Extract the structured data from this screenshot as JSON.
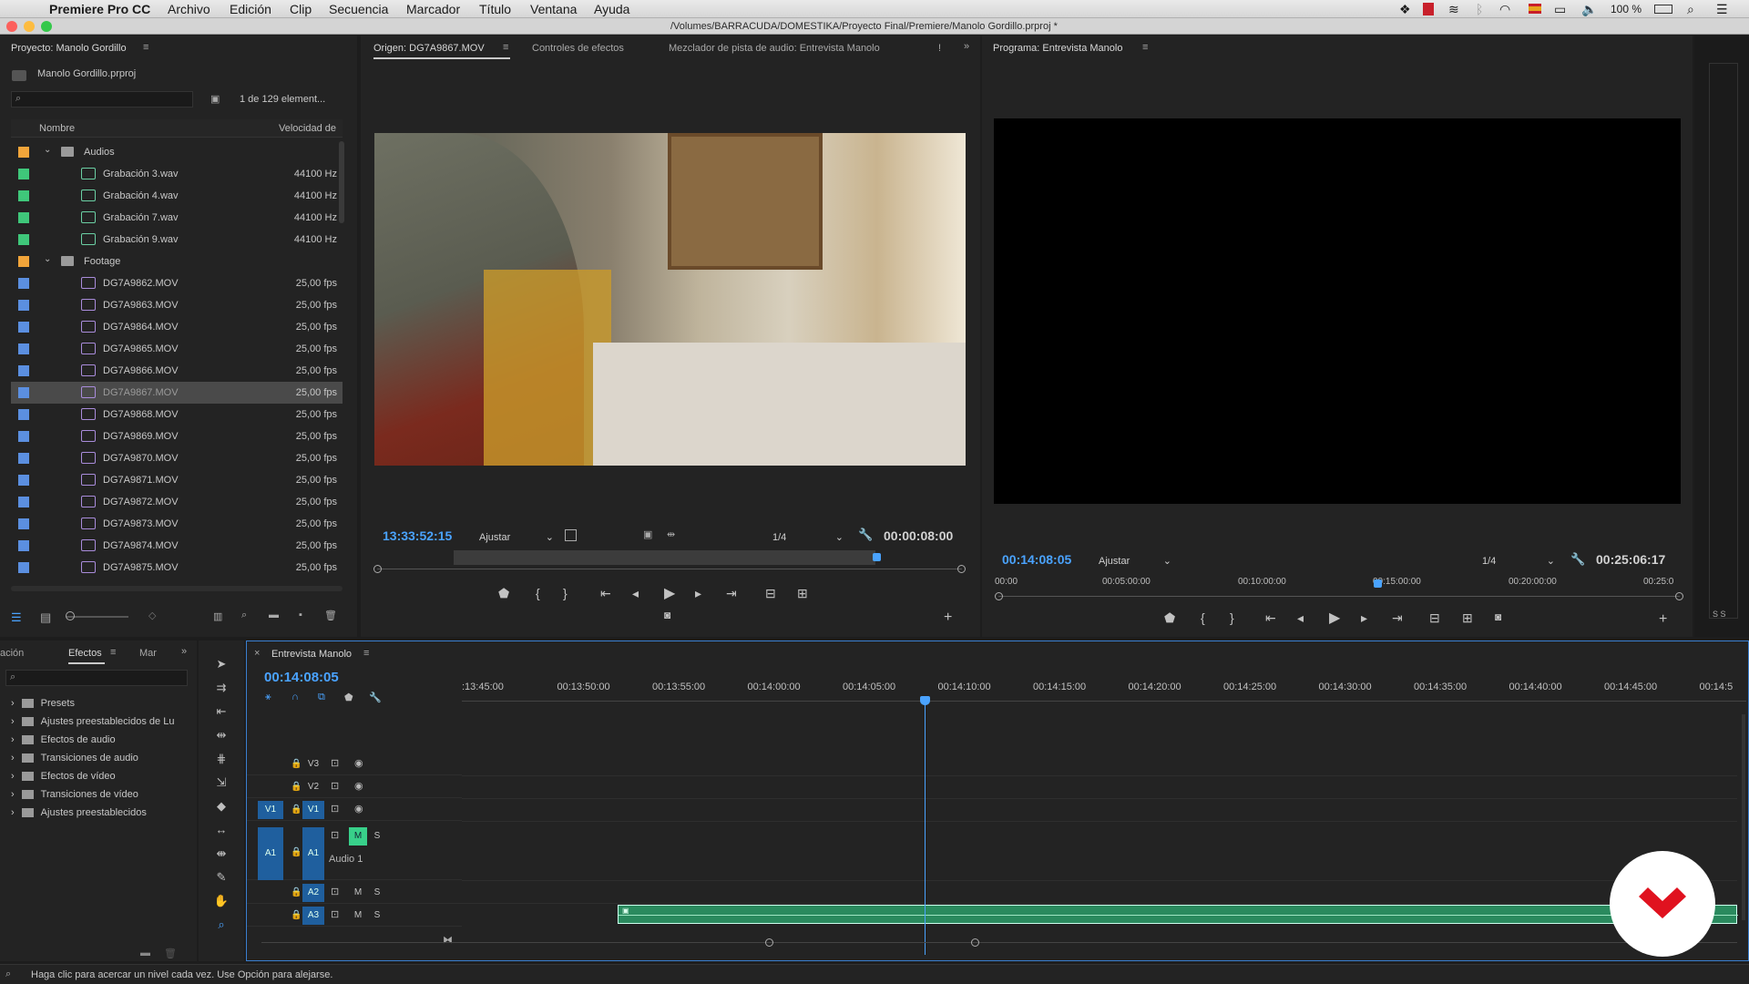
{
  "menubar": {
    "app": "Premiere Pro CC",
    "items": [
      "Archivo",
      "Edición",
      "Clip",
      "Secuencia",
      "Marcador",
      "Título",
      "Ventana",
      "Ayuda"
    ],
    "battery": "100 %"
  },
  "window": {
    "title": "/Volumes/BARRACUDA/DOMESTIKA/Proyecto Final/Premiere/Manolo Gordillo.prproj *"
  },
  "project": {
    "tab": "Proyecto: Manolo Gordillo",
    "file": "Manolo Gordillo.prproj",
    "count": "1 de 129 element...",
    "col_name": "Nombre",
    "col_rate": "Velocidad de",
    "rows": [
      {
        "name": "Audios",
        "rate": "",
        "type": "folder",
        "color": "#f2a53a"
      },
      {
        "name": "Grabación 3.wav",
        "rate": "44100 Hz",
        "type": "audio",
        "color": "#3fc77a"
      },
      {
        "name": "Grabación 4.wav",
        "rate": "44100 Hz",
        "type": "audio",
        "color": "#3fc77a"
      },
      {
        "name": "Grabación 7.wav",
        "rate": "44100 Hz",
        "type": "audio",
        "color": "#3fc77a"
      },
      {
        "name": "Grabación 9.wav",
        "rate": "44100 Hz",
        "type": "audio",
        "color": "#3fc77a"
      },
      {
        "name": "Footage",
        "rate": "",
        "type": "folder",
        "color": "#f2a53a"
      },
      {
        "name": "DG7A9862.MOV",
        "rate": "25,00 fps",
        "type": "video",
        "color": "#5b8fe0"
      },
      {
        "name": "DG7A9863.MOV",
        "rate": "25,00 fps",
        "type": "video",
        "color": "#5b8fe0"
      },
      {
        "name": "DG7A9864.MOV",
        "rate": "25,00 fps",
        "type": "video",
        "color": "#5b8fe0"
      },
      {
        "name": "DG7A9865.MOV",
        "rate": "25,00 fps",
        "type": "video",
        "color": "#5b8fe0"
      },
      {
        "name": "DG7A9866.MOV",
        "rate": "25,00 fps",
        "type": "video",
        "color": "#5b8fe0"
      },
      {
        "name": "DG7A9867.MOV",
        "rate": "25,00 fps",
        "type": "video",
        "color": "#5b8fe0",
        "selected": true
      },
      {
        "name": "DG7A9868.MOV",
        "rate": "25,00 fps",
        "type": "video",
        "color": "#5b8fe0"
      },
      {
        "name": "DG7A9869.MOV",
        "rate": "25,00 fps",
        "type": "video",
        "color": "#5b8fe0"
      },
      {
        "name": "DG7A9870.MOV",
        "rate": "25,00 fps",
        "type": "video",
        "color": "#5b8fe0"
      },
      {
        "name": "DG7A9871.MOV",
        "rate": "25,00 fps",
        "type": "video",
        "color": "#5b8fe0"
      },
      {
        "name": "DG7A9872.MOV",
        "rate": "25,00 fps",
        "type": "video",
        "color": "#5b8fe0"
      },
      {
        "name": "DG7A9873.MOV",
        "rate": "25,00 fps",
        "type": "video",
        "color": "#5b8fe0"
      },
      {
        "name": "DG7A9874.MOV",
        "rate": "25,00 fps",
        "type": "video",
        "color": "#5b8fe0"
      },
      {
        "name": "DG7A9875.MOV",
        "rate": "25,00 fps",
        "type": "video",
        "color": "#5b8fe0"
      }
    ]
  },
  "source": {
    "tabs": [
      "Origen: DG7A9867.MOV",
      "Controles de efectos",
      "Mezclador de pista de audio: Entrevista Manolo"
    ],
    "timecode": "13:33:52:15",
    "fit": "Ajustar",
    "res": "1/4",
    "duration": "00:00:08:00"
  },
  "program": {
    "tab": "Programa: Entrevista Manolo",
    "timecode": "00:14:08:05",
    "fit": "Ajustar",
    "res": "1/4",
    "duration": "00:25:06:17",
    "ruler": [
      "00:00",
      "00:05:00:00",
      "00:10:00:00",
      "00:15:00:00",
      "00:20:00:00",
      "00:25:0"
    ]
  },
  "effects": {
    "tabs": [
      "ación",
      "Efectos",
      "Mar"
    ],
    "items": [
      "Presets",
      "Ajustes preestablecidos de Lu",
      "Efectos de audio",
      "Transiciones de audio",
      "Efectos de vídeo",
      "Transiciones de vídeo",
      "Ajustes preestablecidos"
    ]
  },
  "timeline": {
    "tab": "Entrevista Manolo",
    "timecode": "00:14:08:05",
    "ruler": [
      ":13:45:00",
      "00:13:50:00",
      "00:13:55:00",
      "00:14:00:00",
      "00:14:05:00",
      "00:14:10:00",
      "00:14:15:00",
      "00:14:20:00",
      "00:14:25:00",
      "00:14:30:00",
      "00:14:35:00",
      "00:14:40:00",
      "00:14:45:00",
      "00:14:5"
    ],
    "tracks": {
      "v3": "V3",
      "v2": "V2",
      "v1": "V1",
      "a1": "A1",
      "a2": "A2",
      "a3": "A3",
      "audio1": "Audio 1",
      "m": "M",
      "s": "S"
    }
  },
  "status": {
    "text": "Haga clic para acercar un nivel cada vez. Use Opción para alejarse."
  },
  "colors": {
    "accent": "#4aa3ff",
    "audio_clip": "#2a8a5e",
    "brand": "#e0121f"
  }
}
